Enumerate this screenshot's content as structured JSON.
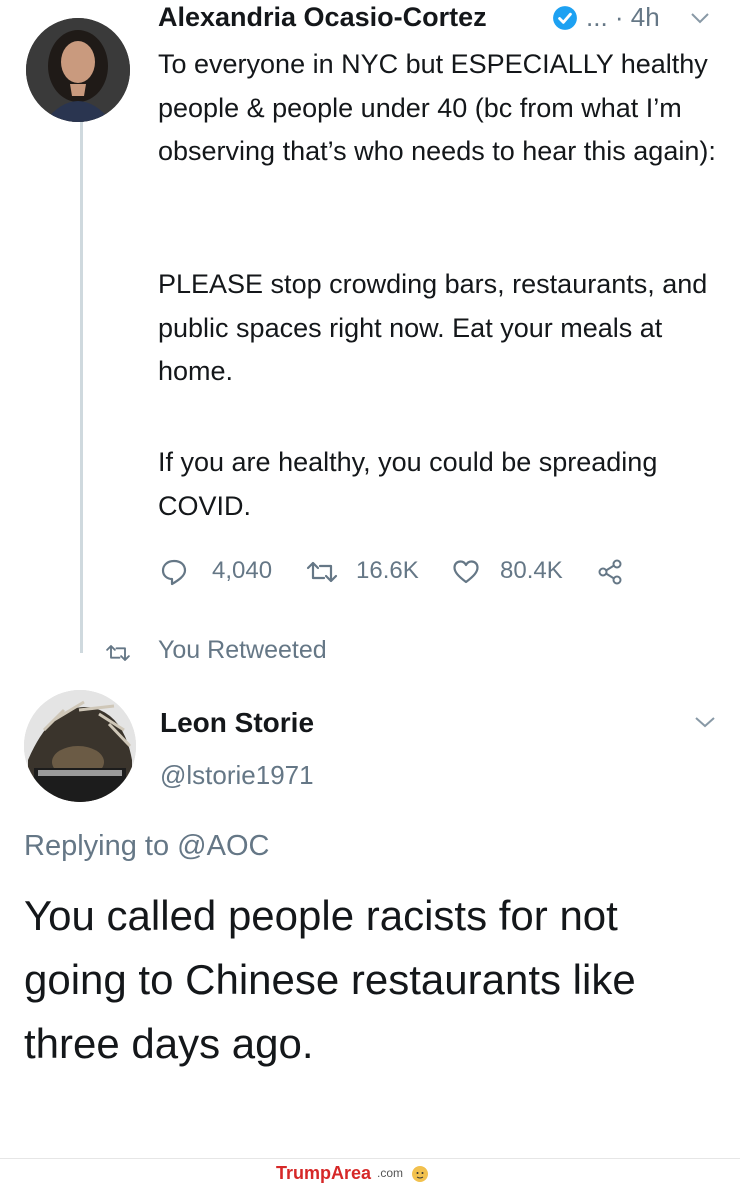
{
  "tweet": {
    "author_name": "Alexandria Ocasio-Cortez",
    "meta": "... · 4h",
    "paragraphs": [
      "To everyone in NYC but ESPECIALLY healthy people & people under 40 (bc from what I’m observing that’s who needs to hear this again):",
      "PLEASE stop crowding bars, restaurants, and public spaces right now. Eat your meals at home.",
      "If you are healthy, you could be spreading COVID."
    ],
    "actions": {
      "replies": "4,040",
      "retweets": "16.6K",
      "likes": "80.4K"
    },
    "retweet_label": "You Retweeted"
  },
  "reply": {
    "author_name": "Leon Storie",
    "handle": "@lstorie1971",
    "replying_prefix": "Replying to",
    "replying_mention": "@AOC",
    "text": "You called people racists for not going to Chinese restaurants like three days ago."
  },
  "footer": {
    "brand_name": "TrumpArea",
    "brand_suffix": ".com"
  },
  "colors": {
    "verified": "#1da1f2",
    "muted": "#657786",
    "text": "#14171a",
    "brand": "#d62828"
  },
  "icons": [
    "verified-badge-icon",
    "chevron-down-icon",
    "reply-icon",
    "retweet-icon",
    "like-icon",
    "share-icon",
    "brand-logo-icon"
  ]
}
